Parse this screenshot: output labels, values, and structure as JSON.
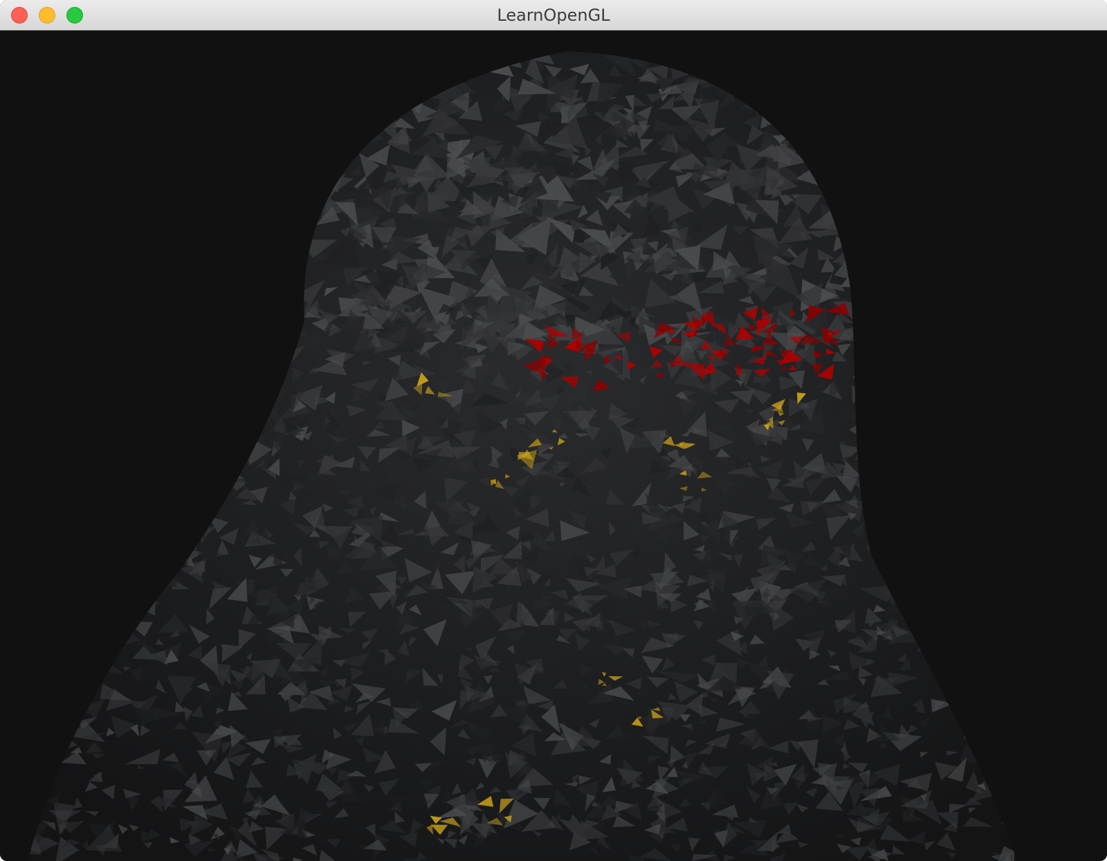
{
  "window": {
    "title": "LearnOpenGL"
  },
  "controls": {
    "close": "close-button",
    "minimize": "minimize-button",
    "zoom": "zoom-button"
  },
  "viewport": {
    "clear_color": "#111111",
    "mesh_color": "#2e2f31",
    "mesh_highlight": "#4a4b4d",
    "accent_red": "#a00000",
    "accent_yellow": "#c9a21a"
  }
}
